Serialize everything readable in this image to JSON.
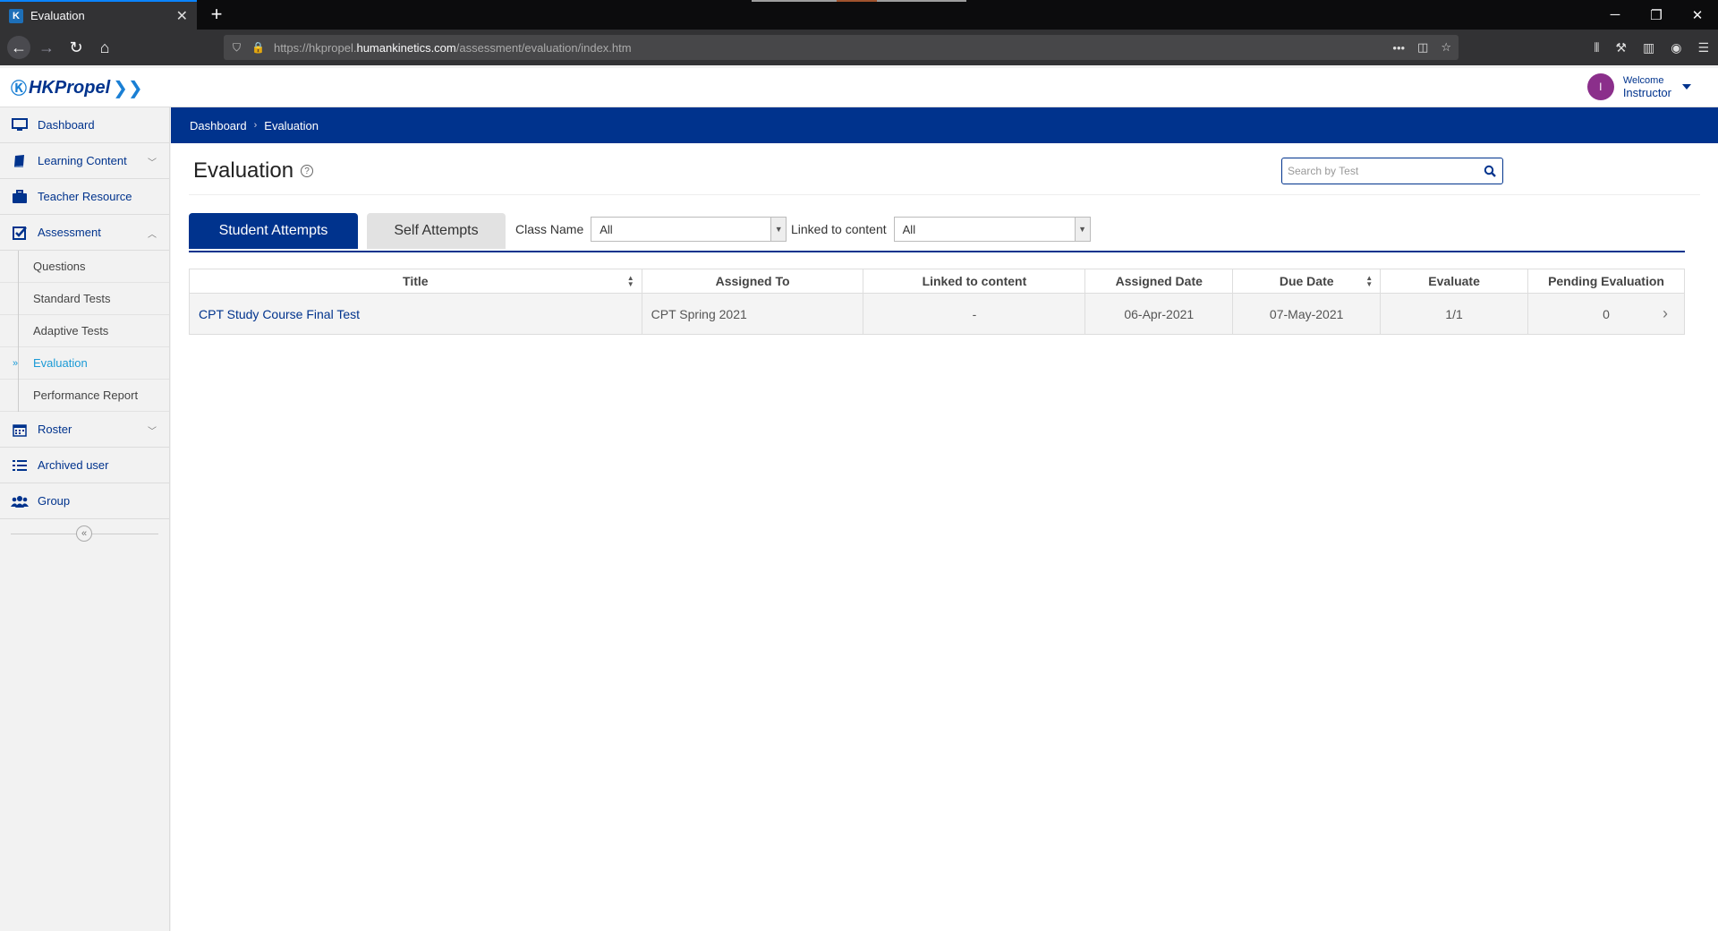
{
  "browser": {
    "tab_title": "Evaluation",
    "new_tab": "+",
    "url_prefix": "https://hkpropel.",
    "url_host": "humankinetics.com",
    "url_path": "/assessment/evaluation/index.htm"
  },
  "header": {
    "logo_text": "HKPropel",
    "avatar_initial": "I",
    "welcome": "Welcome",
    "role": "Instructor"
  },
  "sidebar": {
    "items": [
      {
        "label": "Dashboard",
        "icon": "monitor-icon"
      },
      {
        "label": "Learning Content",
        "icon": "book-icon"
      },
      {
        "label": "Teacher Resource",
        "icon": "briefcase-icon"
      },
      {
        "label": "Assessment",
        "icon": "checkbox-icon"
      },
      {
        "label": "Roster",
        "icon": "calendar-icon"
      },
      {
        "label": "Archived user",
        "icon": "list-icon"
      },
      {
        "label": "Group",
        "icon": "users-icon"
      }
    ],
    "assessment_sub": [
      {
        "label": "Questions"
      },
      {
        "label": "Standard Tests"
      },
      {
        "label": "Adaptive Tests"
      },
      {
        "label": "Evaluation",
        "active": true
      },
      {
        "label": "Performance Report"
      }
    ]
  },
  "breadcrumb": {
    "home": "Dashboard",
    "current": "Evaluation"
  },
  "page": {
    "title": "Evaluation",
    "search_placeholder": "Search by Test"
  },
  "tabs": {
    "student": "Student Attempts",
    "self": "Self Attempts"
  },
  "filters": {
    "class_label": "Class Name",
    "class_value": "All",
    "linked_label": "Linked to content",
    "linked_value": "All"
  },
  "table": {
    "columns": [
      "Title",
      "Assigned To",
      "Linked to content",
      "Assigned Date",
      "Due Date",
      "Evaluate",
      "Pending Evaluation"
    ],
    "rows": [
      {
        "title": "CPT Study Course Final Test",
        "assigned_to": "CPT Spring 2021",
        "linked": "-",
        "assigned_date": "06-Apr-2021",
        "due_date": "07-May-2021",
        "evaluate": "1/1",
        "pending": "0"
      }
    ]
  },
  "colors": {
    "brand_navy": "#00338d",
    "active_link": "#1a9ad6",
    "avatar": "#8b2f8b"
  }
}
